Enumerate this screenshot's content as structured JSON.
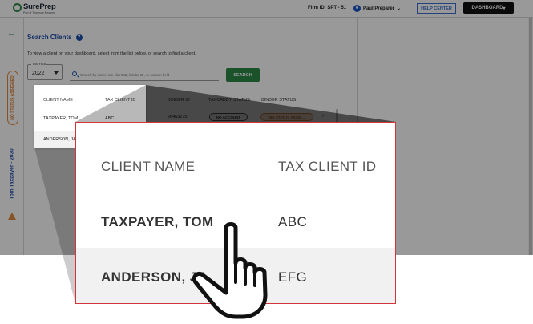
{
  "header": {
    "logo_name": "SurePrep",
    "logo_sub": "Part of Thomson Reuters",
    "firm_id": "Firm ID: SPT - 51",
    "user_name": "Paul Preparer",
    "help_center": "HELP CENTER",
    "dashboard": "DASHBOARD"
  },
  "left_nav": {
    "status": "NO STATUS ASSIGNED",
    "taxpayer": "Tom Taxpayer - 2030"
  },
  "search_page": {
    "title": "Search Clients",
    "instructions": "To view a client on your dashboard, select from the list below, or search to find a client.",
    "tax_year_label": "Tax Year",
    "tax_year_value": "2022",
    "search_placeholder": "Search by name, tax client ID, binder ID, or custom field",
    "search_button": "SEARCH"
  },
  "table": {
    "columns": [
      "CLIENT NAME",
      "TAX CLIENT ID",
      "BINDER ID",
      "TAXCADDY STATUS",
      "BINDER STATUS"
    ],
    "rows": [
      {
        "client_name": "TAXPAYER, TOM",
        "tax_client_id": "ABC",
        "binder_id": "26463275",
        "taxcaddy_status": "NO ACCOUNT",
        "binder_status": "NO STATUS ASSIG..."
      },
      {
        "client_name": "ANDERSON, JA",
        "tax_client_id": "EFG"
      }
    ]
  },
  "colors": {
    "brand_green": "#2c8a47",
    "brand_blue": "#1e4fae",
    "status_orange": "#e08a3c",
    "zoom_border": "#d0353b"
  },
  "icons": [
    "checkmark-logo-icon",
    "user-icon",
    "chevron-down-icon",
    "back-arrow-icon",
    "help-icon",
    "search-icon",
    "warning-icon",
    "chevron-right-icon",
    "pointing-hand-cursor-icon"
  ]
}
